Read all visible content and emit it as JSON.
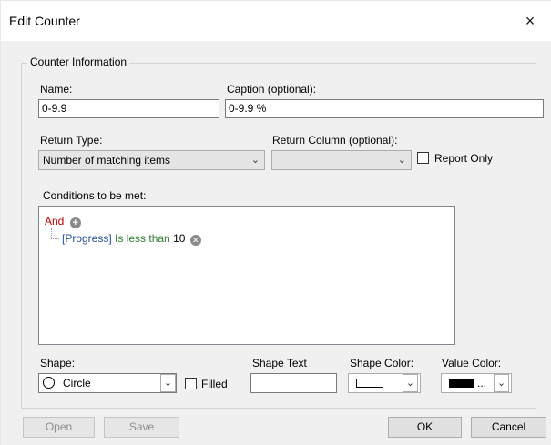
{
  "window": {
    "title": "Edit Counter",
    "close_icon": "×"
  },
  "group": {
    "legend": "Counter Information"
  },
  "name": {
    "label": "Name:",
    "value": "0-9.9"
  },
  "caption": {
    "label": "Caption (optional):",
    "value": "0-9.9 %"
  },
  "return_type": {
    "label": "Return Type:",
    "value": "Number of matching items"
  },
  "return_column": {
    "label": "Return Column (optional):",
    "value": ""
  },
  "report_only": {
    "label": "Report Only",
    "checked": false
  },
  "conditions": {
    "label": "Conditions to be met:",
    "root": "And",
    "items": [
      {
        "field": "[Progress]",
        "operator": "Is less than",
        "value": "10"
      }
    ]
  },
  "shape": {
    "label": "Shape:",
    "value": "Circle",
    "filled_label": "Filled",
    "filled": false
  },
  "shape_text": {
    "label": "Shape Text",
    "value": ""
  },
  "shape_color": {
    "label": "Shape Color:",
    "color": "#ffffff"
  },
  "value_color": {
    "label": "Value Color:",
    "color": "#000000",
    "ellipsis": "..."
  },
  "buttons": {
    "open": "Open",
    "save": "Save",
    "ok": "OK",
    "cancel": "Cancel"
  },
  "icons": {
    "dropdown": "chevron-down-icon",
    "add": "plus-circle-icon",
    "remove": "x-circle-icon",
    "close": "close-icon"
  }
}
